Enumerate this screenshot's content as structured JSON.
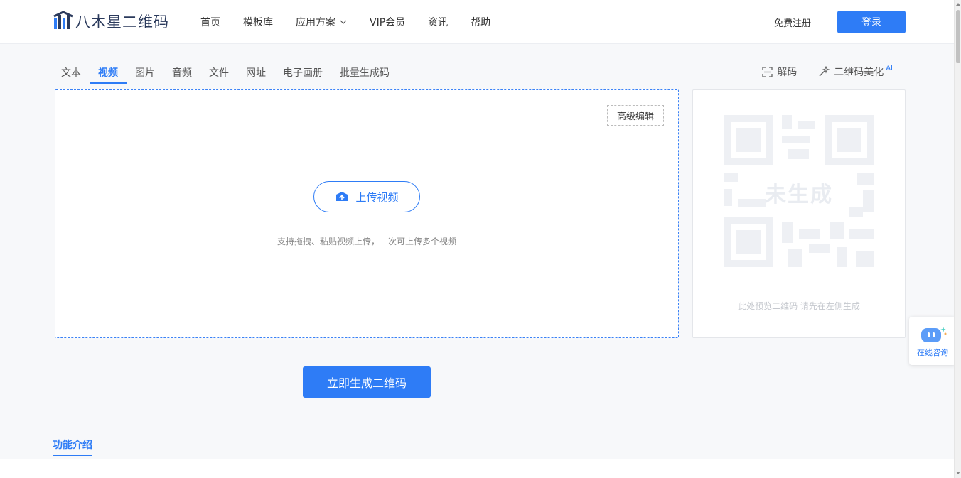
{
  "header": {
    "logo_text": "八木星二维码",
    "nav": [
      "首页",
      "模板库",
      "应用方案",
      "VIP会员",
      "资讯",
      "帮助"
    ],
    "register": "免费注册",
    "login": "登录"
  },
  "tabs": {
    "items": [
      "文本",
      "视频",
      "图片",
      "音频",
      "文件",
      "网址",
      "电子画册",
      "批量生成码"
    ],
    "active": "视频"
  },
  "tools": {
    "decode": "解码",
    "beautify": "二维码美化",
    "ai_tag": "AI"
  },
  "upload": {
    "advanced_edit": "高级编辑",
    "upload_button": "上传视频",
    "hint": "支持拖拽、粘贴视频上传，一次可上传多个视频"
  },
  "preview": {
    "qr_label": "未生成",
    "hint": "此处预览二维码 请先在左侧生成"
  },
  "generate_button": "立即生成二维码",
  "intro_tab": "功能介绍",
  "consult": {
    "label": "在线咨询"
  },
  "colors": {
    "accent": "#2e7cf6",
    "background": "#f7f8fa"
  }
}
